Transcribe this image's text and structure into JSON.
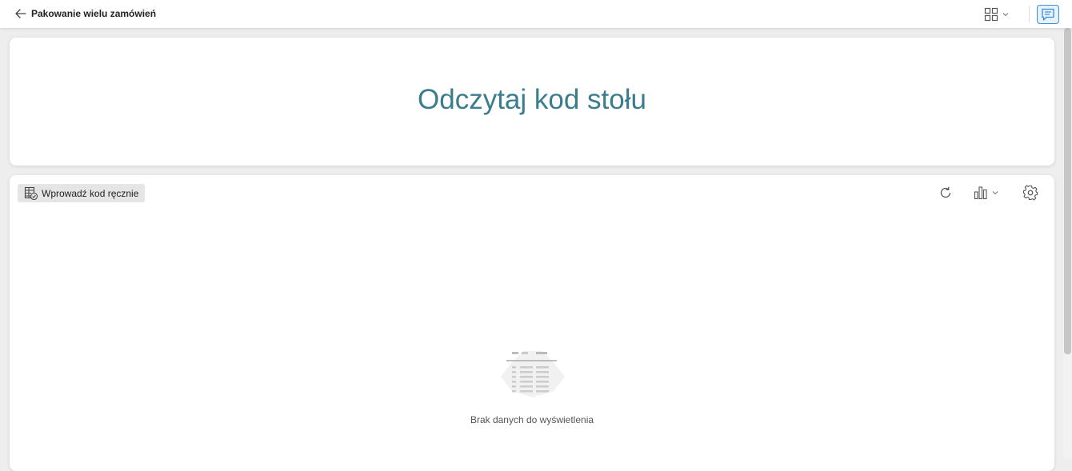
{
  "header": {
    "title": "Pakowanie wielu zamówień",
    "back_icon": "arrow-left-icon",
    "layout_icon": "grid-layout-icon",
    "chat_icon": "chat-icon",
    "accent_color": "#3a8fd6"
  },
  "scan_card": {
    "title": "Odczytaj kod stołu",
    "title_color": "#3b7d8c"
  },
  "table_card": {
    "manual_button_label": "Wprowadź kod ręcznie",
    "manual_button_icon": "table-check-icon",
    "refresh_icon": "refresh-icon",
    "chart_icon": "bar-chart-icon",
    "settings_icon": "gear-icon",
    "empty_state_text": "Brak danych do wyświetlenia",
    "empty_state_icon": "empty-table-icon"
  }
}
